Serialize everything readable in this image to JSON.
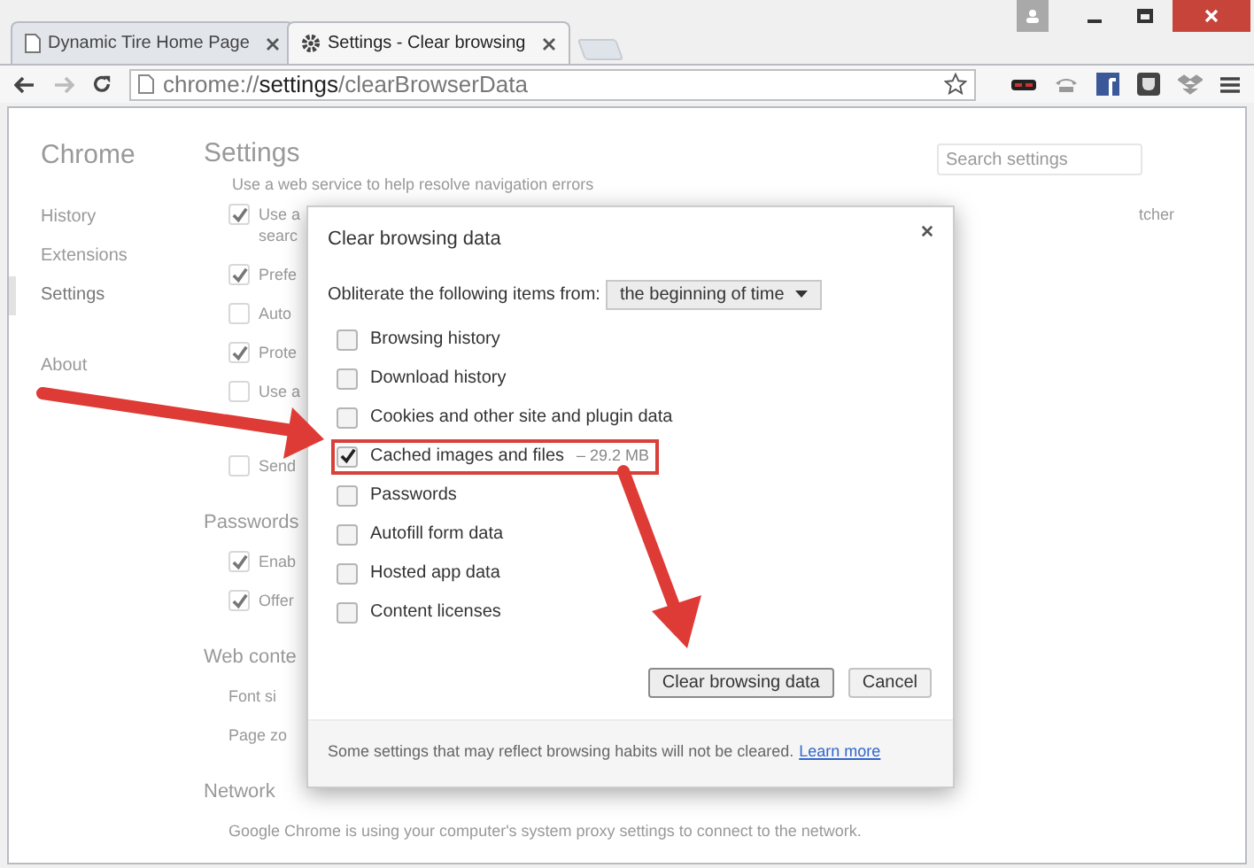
{
  "tabs": [
    {
      "title": "Dynamic Tire Home Page",
      "selected": false,
      "kind": "page"
    },
    {
      "title": "Settings - Clear browsing",
      "selected": true,
      "kind": "settings"
    }
  ],
  "address_bar": {
    "url": "chrome://**settings**/clearBrowserData"
  },
  "sidebar": {
    "title": "Chrome",
    "items": [
      {
        "label": "History",
        "selected": false
      },
      {
        "label": "Extensions",
        "selected": false
      },
      {
        "label": "Settings",
        "selected": true
      },
      {
        "label": "About",
        "selected": false
      }
    ]
  },
  "settings": {
    "title": "Settings",
    "search_placeholder": "Search settings",
    "items": [
      {
        "kind": "text",
        "label": "Use a web service to help resolve navigation errors"
      },
      {
        "kind": "checkbox",
        "label": "Use a",
        "label2": "searc",
        "checked": true,
        "side": "tcher"
      },
      {
        "kind": "checkbox",
        "label": "Prefe",
        "checked": true
      },
      {
        "kind": "checkbox",
        "label": "Auto",
        "checked": false
      },
      {
        "kind": "checkbox",
        "label": "Prote",
        "checked": true
      },
      {
        "kind": "checkbox",
        "label": "Use a",
        "checked": false
      },
      {
        "kind": "gap"
      },
      {
        "kind": "checkbox",
        "label": "Send",
        "checked": false
      },
      {
        "kind": "heading",
        "label": "Passwords"
      },
      {
        "kind": "checkbox",
        "label": "Enab",
        "checked": true
      },
      {
        "kind": "checkbox",
        "label": "Offer",
        "checked": true
      },
      {
        "kind": "heading",
        "label": "Web conte"
      },
      {
        "kind": "text",
        "label": "Font si"
      },
      {
        "kind": "text",
        "label": "Page zo"
      },
      {
        "kind": "heading",
        "label": "Network"
      },
      {
        "kind": "text",
        "label": "Google Chrome is using your computer's system proxy settings to connect to the network."
      }
    ]
  },
  "dialog": {
    "title": "Clear browsing data",
    "from_label": "Obliterate the following items from:",
    "from_value": "the beginning of time",
    "options": [
      {
        "label": "Browsing history",
        "checked": false,
        "highlighted": false
      },
      {
        "label": "Download history",
        "checked": false,
        "highlighted": false
      },
      {
        "label": "Cookies and other site and plugin data",
        "checked": false,
        "highlighted": false
      },
      {
        "label": "Cached images and files",
        "size": "–  29.2 MB",
        "checked": true,
        "highlighted": true
      },
      {
        "label": "Passwords",
        "checked": false,
        "highlighted": false
      },
      {
        "label": "Autofill form data",
        "checked": false,
        "highlighted": false
      },
      {
        "label": "Hosted app data",
        "checked": false,
        "highlighted": false
      },
      {
        "label": "Content licenses",
        "checked": false,
        "highlighted": false
      }
    ],
    "buttons": [
      {
        "label": "Clear browsing data",
        "kind": "primary"
      },
      {
        "label": "Cancel",
        "kind": "secondary"
      }
    ],
    "footer": "Some settings that may reflect browsing habits will not be cleared.",
    "footer_link": "Learn more"
  }
}
